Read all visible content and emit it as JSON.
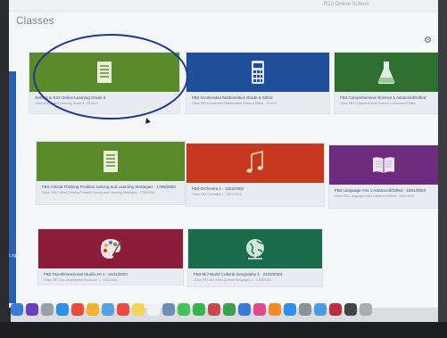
{
  "page": {
    "title": "Classes",
    "topbar_text": "R12 Online School"
  },
  "left_strip_text": "Log in",
  "cards": [
    {
      "name": "Getting to K12 Online Learning Grade 6",
      "sub": "Class K12 Online Learning Grade 6 · 2016/17",
      "color": "#5a8a2a",
      "icon": "document-icon"
    },
    {
      "name": "FB3 Accelerated Mathematics Grade 6 Gifted",
      "sub": "Class FB3 Accelerated Mathematics Grade 6 Gifted · 2016/17",
      "color": "#1f4e9a",
      "icon": "calculator-icon"
    },
    {
      "name": "FB3 Comprehensive Science 1 Advanced/Gifted",
      "sub": "Class FB3 Comprehensive Science 1 Advanced/Gifted",
      "color": "#2f7031",
      "icon": "flask-icon"
    },
    {
      "name": "FB3 Critical Thinking Problem Solving and Learning Strategies · 1785/2003",
      "sub": "Class FB3 Critical Thinking Problem Solving and Learning Strategies · 1785/2003",
      "color": "#5a8a2a",
      "icon": "document-icon"
    },
    {
      "name": "FB3 Orchestra 1 · 1302/2003",
      "sub": "Class FB3 Orchestra 1 · 1302/2003",
      "color": "#c6391f",
      "icon": "music-note-icon"
    },
    {
      "name": "FB3 Language Arts 1 Advanced/Gifted · 1001/2003",
      "sub": "Class FB3 Language Arts 1 Advanced/Gifted · 1001/2003",
      "color": "#6d2c7e",
      "icon": "book-icon"
    },
    {
      "name": "FB3 Two-Dimensional Studio Art 1 · 0101/2003",
      "sub": "Class FB3 Two-Dimensional Studio Art 1 · 0101/2003",
      "color": "#8b1c3a",
      "icon": "palette-icon"
    },
    {
      "name": "FB3 M/J World Cultural Geography 1 · 2103/2003",
      "sub": "Class FB3 M/J World Cultural Geography 1 · 2103/2003",
      "color": "#1a6b4a",
      "icon": "globe-icon"
    }
  ],
  "dock": [
    {
      "icon": "finder-icon",
      "color": "#3a7bd5"
    },
    {
      "icon": "siri-icon",
      "color": "#6a3fb8"
    },
    {
      "icon": "launchpad-icon",
      "color": "#9aa0a6"
    },
    {
      "icon": "safari-icon",
      "color": "#2d8fe6"
    },
    {
      "icon": "chrome-icon",
      "color": "#e34f3c"
    },
    {
      "icon": "photos-icon",
      "color": "#f2b134"
    },
    {
      "icon": "mail-icon",
      "color": "#5aa0e0"
    },
    {
      "icon": "calendar-icon",
      "color": "#e84c3d"
    },
    {
      "icon": "notes-icon",
      "color": "#f5d35a"
    },
    {
      "icon": "reminders-icon",
      "color": "#f0f0f0"
    },
    {
      "icon": "preview-icon",
      "color": "#6c8fb5"
    },
    {
      "icon": "messages-icon",
      "color": "#44c35b"
    },
    {
      "icon": "facetime-icon",
      "color": "#3bb34a"
    },
    {
      "icon": "photo-booth-icon",
      "color": "#c84b4b"
    },
    {
      "icon": "numbers-icon",
      "color": "#3aa04a"
    },
    {
      "icon": "keynote-icon",
      "color": "#3b7ad8"
    },
    {
      "icon": "itunes-icon",
      "color": "#e04a8a"
    },
    {
      "icon": "ibooks-icon",
      "color": "#f28a2a"
    },
    {
      "icon": "app-store-icon",
      "color": "#2f8ee6"
    },
    {
      "icon": "system-preferences-icon",
      "color": "#8c9098"
    },
    {
      "icon": "mail-stamp-icon",
      "color": "#4c9be0"
    },
    {
      "icon": "slack-icon",
      "color": "#b6303f"
    },
    {
      "icon": "calculator-app-icon",
      "color": "#444"
    },
    {
      "icon": "trash-icon",
      "color": "#a8adb3"
    }
  ]
}
